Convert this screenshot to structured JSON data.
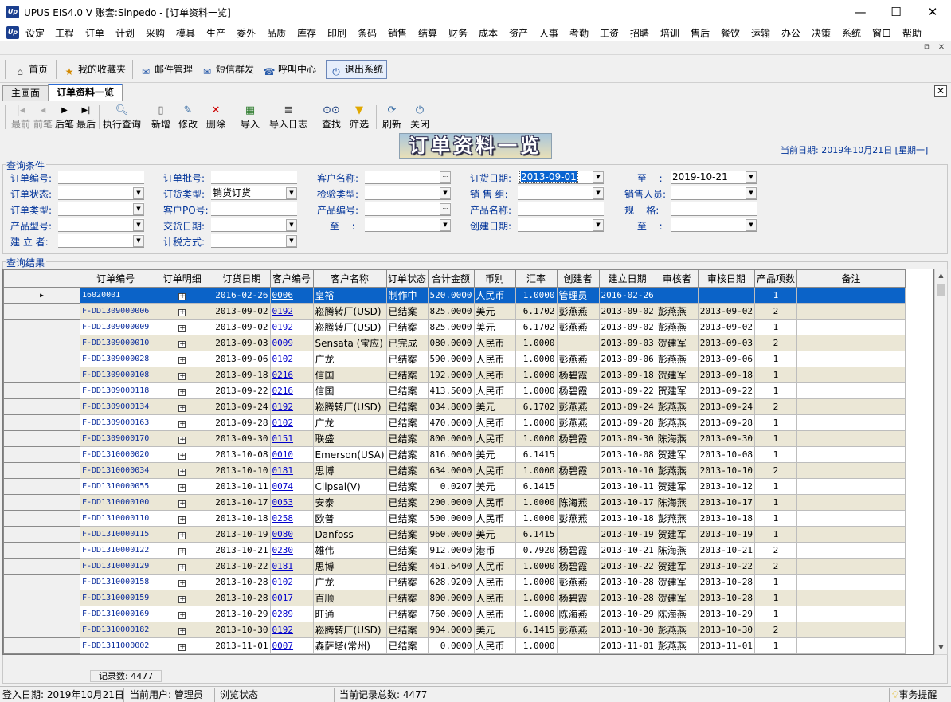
{
  "window": {
    "title": "UPUS EIS4.0 V 账套:Sinpedo - [订单资料一览]",
    "icon": "Up"
  },
  "menu": [
    "设定",
    "工程",
    "订单",
    "计划",
    "采购",
    "模具",
    "生产",
    "委外",
    "品质",
    "库存",
    "印刷",
    "条码",
    "销售",
    "结算",
    "财务",
    "成本",
    "资产",
    "人事",
    "考勤",
    "工资",
    "招聘",
    "培训",
    "售后",
    "餐饮",
    "运输",
    "办公",
    "决策",
    "系统",
    "窗口",
    "帮助"
  ],
  "quickbar": [
    {
      "label": "首页",
      "icon": "home-icon"
    },
    {
      "label": "我的收藏夹",
      "icon": "favorites-icon"
    },
    {
      "label": "邮件管理",
      "icon": "mail-icon"
    },
    {
      "label": "短信群发",
      "icon": "sms-icon"
    },
    {
      "label": "呼叫中心",
      "icon": "call-center-icon"
    },
    {
      "label": "退出系统",
      "icon": "power-icon"
    }
  ],
  "tabs": [
    {
      "label": "主画面"
    },
    {
      "label": "订单资料一览"
    }
  ],
  "toolbar": [
    {
      "label": "最前",
      "icon": "first-icon",
      "enabled": false
    },
    {
      "label": "前笔",
      "icon": "prev-icon",
      "enabled": false
    },
    {
      "label": "后笔",
      "icon": "next-icon",
      "enabled": true
    },
    {
      "label": "最后",
      "icon": "last-icon",
      "enabled": true
    },
    {
      "label": "执行查询",
      "icon": "query-icon",
      "enabled": true
    },
    {
      "label": "新增",
      "icon": "new-icon",
      "enabled": true
    },
    {
      "label": "修改",
      "icon": "edit-icon",
      "enabled": true
    },
    {
      "label": "删除",
      "icon": "delete-icon",
      "enabled": true
    },
    {
      "label": "导入",
      "icon": "import-icon",
      "enabled": true
    },
    {
      "label": "导入日志",
      "icon": "import-log-icon",
      "enabled": true
    },
    {
      "label": "查找",
      "icon": "find-icon",
      "enabled": true
    },
    {
      "label": "筛选",
      "icon": "filter-icon",
      "enabled": true
    },
    {
      "label": "刷新",
      "icon": "refresh-icon",
      "enabled": true
    },
    {
      "label": "关闭",
      "icon": "close-icon",
      "enabled": true
    }
  ],
  "banner": "订单资料一览",
  "current_date": "当前日期: 2019年10月21日 [星期一]",
  "query": {
    "group_label": "查询条件",
    "fields": [
      {
        "label": "订单编号:",
        "value": "",
        "kind": "text"
      },
      {
        "label": "订单批号:",
        "value": "",
        "kind": "text"
      },
      {
        "label": "客户名称:",
        "value": "",
        "kind": "lookup"
      },
      {
        "label": "订货日期:",
        "value": "2013-09-01",
        "kind": "combo",
        "selected": true
      },
      {
        "label": "一 至 一:",
        "value": "2019-10-21",
        "kind": "combo"
      },
      {
        "label": "订单状态:",
        "value": "",
        "kind": "combo"
      },
      {
        "label": "订货类型:",
        "value": "销货订货",
        "kind": "combo"
      },
      {
        "label": "检验类型:",
        "value": "",
        "kind": "combo"
      },
      {
        "label": "销 售 组:",
        "value": "",
        "kind": "combo"
      },
      {
        "label": "销售人员:",
        "value": "",
        "kind": "combo"
      },
      {
        "label": "订单类型:",
        "value": "",
        "kind": "combo"
      },
      {
        "label": "客户PO号:",
        "value": "",
        "kind": "text"
      },
      {
        "label": "产品编号:",
        "value": "",
        "kind": "lookup"
      },
      {
        "label": "产品名称:",
        "value": "",
        "kind": "text"
      },
      {
        "label": "规    格:",
        "value": "",
        "kind": "text"
      },
      {
        "label": "产品型号:",
        "value": "",
        "kind": "combo"
      },
      {
        "label": "交货日期:",
        "value": "",
        "kind": "combo"
      },
      {
        "label": "一 至 一:",
        "value": "",
        "kind": "combo"
      },
      {
        "label": "创建日期:",
        "value": "",
        "kind": "combo"
      },
      {
        "label": "一 至 一:",
        "value": "",
        "kind": "combo"
      },
      {
        "label": "建 立 者:",
        "value": "",
        "kind": "combo"
      },
      {
        "label": "计税方式:",
        "value": "",
        "kind": "combo"
      }
    ]
  },
  "results": {
    "group_label": "查询结果",
    "columns": [
      "订单编号",
      "订单明细",
      "订货日期",
      "客户编号",
      "客户名称",
      "订单状态",
      "合计金额",
      "币别",
      "汇率",
      "创建者",
      "建立日期",
      "审核者",
      "审核日期",
      "产品项数",
      "备注"
    ],
    "rows": [
      [
        "16020001",
        "+",
        "2016-02-26",
        "0006",
        "皇裕",
        "制作中",
        "520.0000",
        "人民币",
        "1.0000",
        "管理员",
        "2016-02-26",
        "",
        "",
        "1",
        ""
      ],
      [
        "F-DD1309000006",
        "+",
        "2013-09-02",
        "0192",
        "崧腾转厂(USD)",
        "已结案",
        "825.0000",
        "美元",
        "6.1702",
        "彭燕燕",
        "2013-09-02",
        "彭燕燕",
        "2013-09-02",
        "2",
        ""
      ],
      [
        "F-DD1309000009",
        "+",
        "2013-09-02",
        "0192",
        "崧腾转厂(USD)",
        "已结案",
        "825.0000",
        "美元",
        "6.1702",
        "彭燕燕",
        "2013-09-02",
        "彭燕燕",
        "2013-09-02",
        "1",
        ""
      ],
      [
        "F-DD1309000010",
        "+",
        "2013-09-03",
        "0009",
        "Sensata (宝应)",
        "已完成",
        "080.0000",
        "人民币",
        "1.0000",
        "",
        "2013-09-03",
        "贺建军",
        "2013-09-03",
        "2",
        ""
      ],
      [
        "F-DD1309000028",
        "+",
        "2013-09-06",
        "0102",
        "广龙",
        "已结案",
        "590.0000",
        "人民币",
        "1.0000",
        "彭燕燕",
        "2013-09-06",
        "彭燕燕",
        "2013-09-06",
        "1",
        ""
      ],
      [
        "F-DD1309000108",
        "+",
        "2013-09-18",
        "0216",
        "信国",
        "已结案",
        "192.0000",
        "人民币",
        "1.0000",
        "杨碧霞",
        "2013-09-18",
        "贺建军",
        "2013-09-18",
        "1",
        ""
      ],
      [
        "F-DD1309000118",
        "+",
        "2013-09-22",
        "0216",
        "信国",
        "已结案",
        "413.5000",
        "人民币",
        "1.0000",
        "杨碧霞",
        "2013-09-22",
        "贺建军",
        "2013-09-22",
        "1",
        ""
      ],
      [
        "F-DD1309000134",
        "+",
        "2013-09-24",
        "0192",
        "崧腾转厂(USD)",
        "已结案",
        "034.8000",
        "美元",
        "6.1702",
        "彭燕燕",
        "2013-09-24",
        "彭燕燕",
        "2013-09-24",
        "2",
        ""
      ],
      [
        "F-DD1309000163",
        "+",
        "2013-09-28",
        "0102",
        "广龙",
        "已结案",
        "470.0000",
        "人民币",
        "1.0000",
        "彭燕燕",
        "2013-09-28",
        "彭燕燕",
        "2013-09-28",
        "1",
        ""
      ],
      [
        "F-DD1309000170",
        "+",
        "2013-09-30",
        "0151",
        "联盛",
        "已结案",
        "800.0000",
        "人民币",
        "1.0000",
        "杨碧霞",
        "2013-09-30",
        "陈海燕",
        "2013-09-30",
        "1",
        ""
      ],
      [
        "F-DD1310000020",
        "+",
        "2013-10-08",
        "0010",
        "Emerson(USA)",
        "已结案",
        "816.0000",
        "美元",
        "6.1415",
        "",
        "2013-10-08",
        "贺建军",
        "2013-10-08",
        "1",
        ""
      ],
      [
        "F-DD1310000034",
        "+",
        "2013-10-10",
        "0181",
        "思博",
        "已结案",
        "634.0000",
        "人民币",
        "1.0000",
        "杨碧霞",
        "2013-10-10",
        "彭燕燕",
        "2013-10-10",
        "2",
        ""
      ],
      [
        "F-DD1310000055",
        "+",
        "2013-10-11",
        "0074",
        "Clipsal(V)",
        "已结案",
        "0.0207",
        "美元",
        "6.1415",
        "",
        "2013-10-11",
        "贺建军",
        "2013-10-12",
        "1",
        ""
      ],
      [
        "F-DD1310000100",
        "+",
        "2013-10-17",
        "0053",
        "安泰",
        "已结案",
        "200.0000",
        "人民币",
        "1.0000",
        "陈海燕",
        "2013-10-17",
        "陈海燕",
        "2013-10-17",
        "1",
        ""
      ],
      [
        "F-DD1310000110",
        "+",
        "2013-10-18",
        "0258",
        "欧普",
        "已结案",
        "500.0000",
        "人民币",
        "1.0000",
        "彭燕燕",
        "2013-10-18",
        "彭燕燕",
        "2013-10-18",
        "1",
        ""
      ],
      [
        "F-DD1310000115",
        "+",
        "2013-10-19",
        "0080",
        "Danfoss",
        "已结案",
        "960.0000",
        "美元",
        "6.1415",
        "",
        "2013-10-19",
        "贺建军",
        "2013-10-19",
        "1",
        ""
      ],
      [
        "F-DD1310000122",
        "+",
        "2013-10-21",
        "0230",
        "雄伟",
        "已结案",
        "912.0000",
        "港币",
        "0.7920",
        "杨碧霞",
        "2013-10-21",
        "陈海燕",
        "2013-10-21",
        "2",
        ""
      ],
      [
        "F-DD1310000129",
        "+",
        "2013-10-22",
        "0181",
        "思博",
        "已结案",
        "461.6400",
        "人民币",
        "1.0000",
        "杨碧霞",
        "2013-10-22",
        "贺建军",
        "2013-10-22",
        "2",
        ""
      ],
      [
        "F-DD1310000158",
        "+",
        "2013-10-28",
        "0102",
        "广龙",
        "已结案",
        "628.9200",
        "人民币",
        "1.0000",
        "彭燕燕",
        "2013-10-28",
        "贺建军",
        "2013-10-28",
        "1",
        ""
      ],
      [
        "F-DD1310000159",
        "+",
        "2013-10-28",
        "0017",
        "百顺",
        "已结案",
        "800.0000",
        "人民币",
        "1.0000",
        "杨碧霞",
        "2013-10-28",
        "贺建军",
        "2013-10-28",
        "1",
        ""
      ],
      [
        "F-DD1310000169",
        "+",
        "2013-10-29",
        "0289",
        "旺通",
        "已结案",
        "760.0000",
        "人民币",
        "1.0000",
        "陈海燕",
        "2013-10-29",
        "陈海燕",
        "2013-10-29",
        "1",
        ""
      ],
      [
        "F-DD1310000182",
        "+",
        "2013-10-30",
        "0192",
        "崧腾转厂(USD)",
        "已结案",
        "904.0000",
        "美元",
        "6.1415",
        "彭燕燕",
        "2013-10-30",
        "彭燕燕",
        "2013-10-30",
        "2",
        ""
      ],
      [
        "F-DD1311000002",
        "+",
        "2013-11-01",
        "0007",
        "森萨塔(常州)",
        "已结案",
        "0.0000",
        "人民币",
        "1.0000",
        "",
        "2013-11-01",
        "彭燕燕",
        "2013-11-01",
        "1",
        ""
      ]
    ],
    "record_count": "记录数: 4477"
  },
  "status": {
    "login_date": "登入日期: 2019年10月21日",
    "user": "当前用户: 管理员",
    "mode": "浏览状态",
    "total": "当前记录总数: 4477",
    "reminder": "事务提醒"
  },
  "colors": {
    "selection": "#0b63c8",
    "row_alt": "#ebe7d6",
    "label_blue": "#003399",
    "code_blue": "#0b2d9c"
  }
}
